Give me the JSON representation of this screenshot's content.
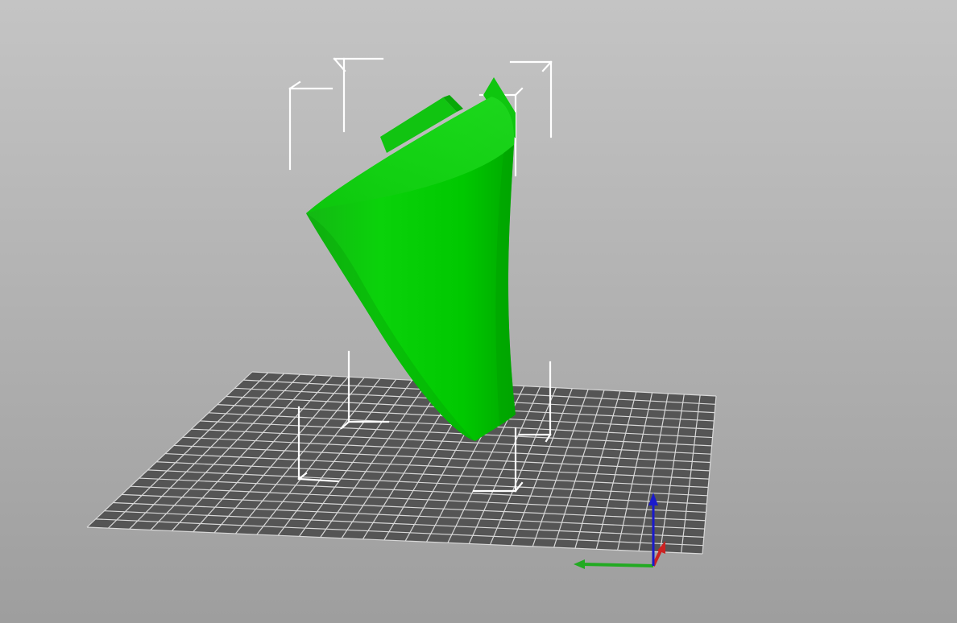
{
  "viewport": {
    "background_top": "#c4c4c4",
    "background_bottom": "#9e9e9e"
  },
  "bed": {
    "fill": "#555555",
    "grid_color": "#d8d8d8",
    "grid_rows": 19,
    "grid_cols": 29
  },
  "model": {
    "color": "#00cc00",
    "selected": true
  },
  "axes": {
    "x_color": "#cc2222",
    "y_color": "#22aa22",
    "z_color": "#1a1acc"
  }
}
